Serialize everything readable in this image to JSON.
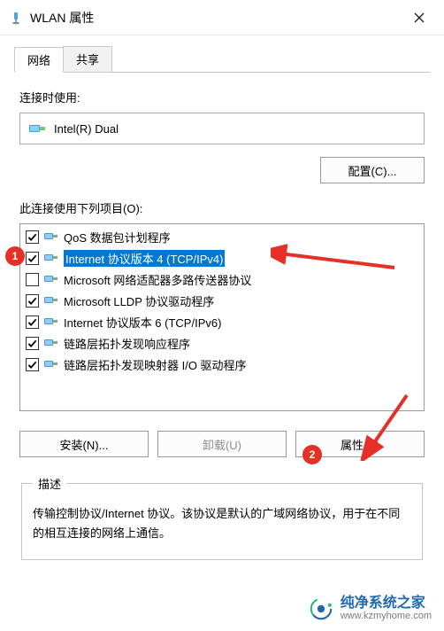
{
  "window": {
    "title": "WLAN 属性"
  },
  "tabs": {
    "network": "网络",
    "share": "共享"
  },
  "adapter": {
    "label": "连接时使用:",
    "name": "Intel(R) Dual",
    "configure_btn": "配置(C)..."
  },
  "components": {
    "label": "此连接使用下列项目(O):",
    "items": [
      {
        "checked": true,
        "label": "QoS 数据包计划程序",
        "icon": "net"
      },
      {
        "checked": true,
        "label": "Internet 协议版本 4 (TCP/IPv4)",
        "icon": "net",
        "selected": true
      },
      {
        "checked": false,
        "label": "Microsoft 网络适配器多路传送器协议",
        "icon": "net"
      },
      {
        "checked": true,
        "label": "Microsoft LLDP 协议驱动程序",
        "icon": "net"
      },
      {
        "checked": true,
        "label": "Internet 协议版本 6 (TCP/IPv6)",
        "icon": "net"
      },
      {
        "checked": true,
        "label": "链路层拓扑发现响应程序",
        "icon": "net"
      },
      {
        "checked": true,
        "label": "链路层拓扑发现映射器 I/O 驱动程序",
        "icon": "net"
      }
    ]
  },
  "buttons": {
    "install": "安装(N)...",
    "uninstall": "卸载(U)",
    "properties": "属性(R)"
  },
  "description": {
    "legend": "描述",
    "text": "传输控制协议/Internet 协议。该协议是默认的广域网络协议，用于在不同的相互连接的网络上通信。"
  },
  "annotations": {
    "one": "1",
    "two": "2"
  },
  "watermark": {
    "cn": "纯净系统之家",
    "url": "www.kzmyhome.com"
  }
}
